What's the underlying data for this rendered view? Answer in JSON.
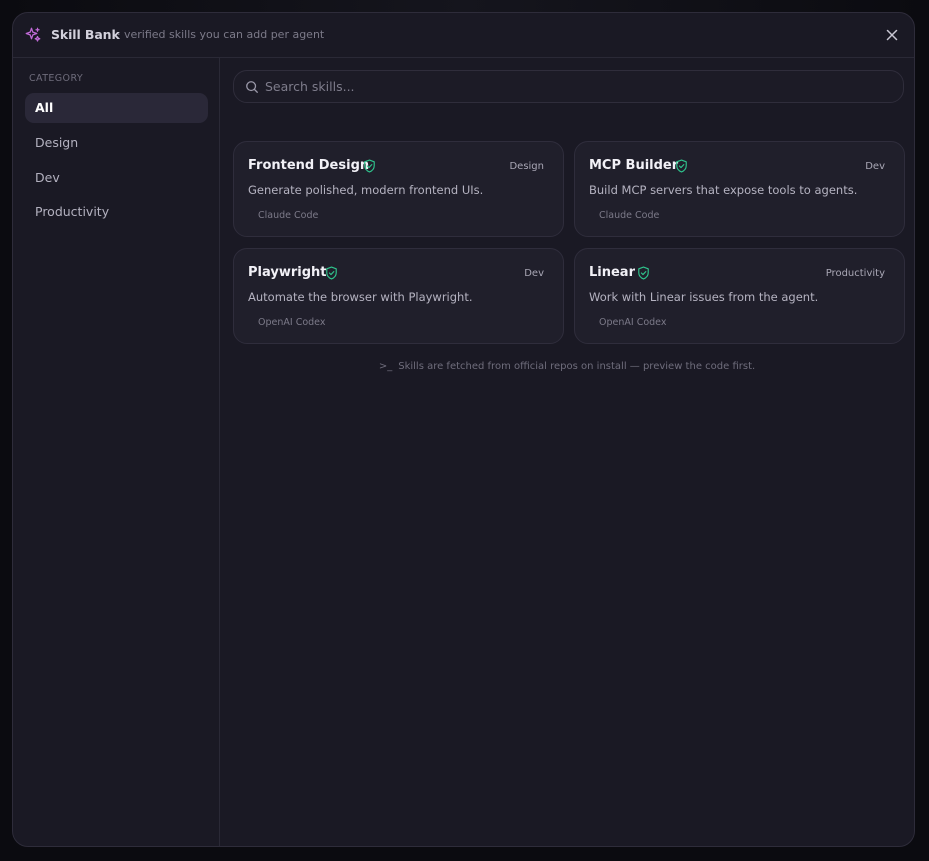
{
  "header": {
    "title": "Skill Bank",
    "subtitle": "· verified skills you can add per agent",
    "brand_icon": "sparkles-icon",
    "close_icon": "close-icon"
  },
  "sidebar": {
    "heading": "CATEGORY",
    "items": [
      {
        "label": "All",
        "active": true
      },
      {
        "label": "Design",
        "active": false
      },
      {
        "label": "Dev",
        "active": false
      },
      {
        "label": "Productivity",
        "active": false
      }
    ]
  },
  "search": {
    "placeholder": "Search skills...",
    "value": ""
  },
  "skills": [
    {
      "name": "Frontend Design",
      "category": "Design",
      "description": "Generate polished, modern frontend UIs.",
      "source": "Claude Code",
      "verified": true
    },
    {
      "name": "MCP Builder",
      "category": "Dev",
      "description": "Build MCP servers that expose tools to agents.",
      "source": "Claude Code",
      "verified": true
    },
    {
      "name": "Playwright",
      "category": "Dev",
      "description": "Automate the browser with Playwright.",
      "source": "OpenAI Codex",
      "verified": true
    },
    {
      "name": "Linear",
      "category": "Productivity",
      "description": "Work with Linear issues from the agent.",
      "source": "OpenAI Codex",
      "verified": true
    }
  ],
  "footnote": {
    "prompt": ">_",
    "text": "Skills are fetched from official repos on install — preview the code first."
  },
  "colors": {
    "accent": "#c06ad6",
    "verified": "#2fc48d",
    "background": "#1a1924"
  }
}
